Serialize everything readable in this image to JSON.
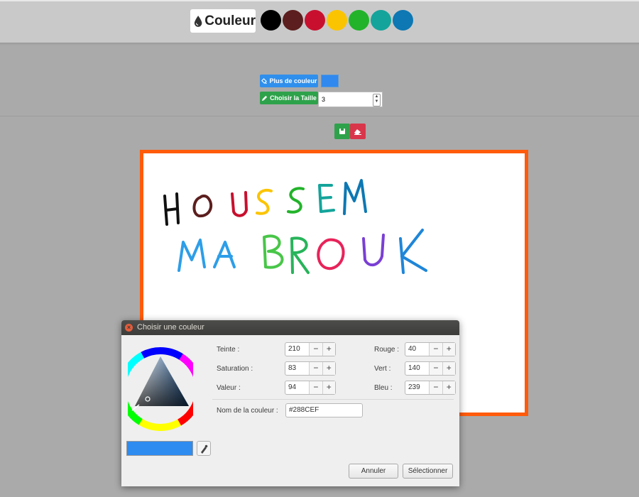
{
  "toolbar": {
    "title": "Couleur",
    "swatches": [
      {
        "name": "black",
        "color": "#000000"
      },
      {
        "name": "dark-red",
        "color": "#5c1e1e"
      },
      {
        "name": "red",
        "color": "#c8102e"
      },
      {
        "name": "yellow",
        "color": "#fbc400"
      },
      {
        "name": "green",
        "color": "#22b32a"
      },
      {
        "name": "teal",
        "color": "#14a49b"
      },
      {
        "name": "blue",
        "color": "#0d78b3"
      }
    ]
  },
  "controls": {
    "more_color_label": "Plus de couleur",
    "choose_size_label": "Choisir la Taille",
    "size_value": "3",
    "current_color": "#2f89ee"
  },
  "canvas": {
    "border_color": "#ff5b0b"
  },
  "dialog": {
    "title": "Choisir une couleur",
    "hue_label": "Teinte :",
    "hue_value": "210",
    "saturation_label": "Saturation :",
    "saturation_value": "83",
    "value_label": "Valeur :",
    "value_value": "94",
    "red_label": "Rouge :",
    "red_value": "40",
    "green_label": "Vert :",
    "green_value": "140",
    "blue_label": "Bleu :",
    "blue_value": "239",
    "color_name_label": "Nom de la couleur :",
    "color_name_value": "#288CEF",
    "cancel_label": "Annuler",
    "select_label": "Sélectionner",
    "minus": "−",
    "plus": "+"
  }
}
